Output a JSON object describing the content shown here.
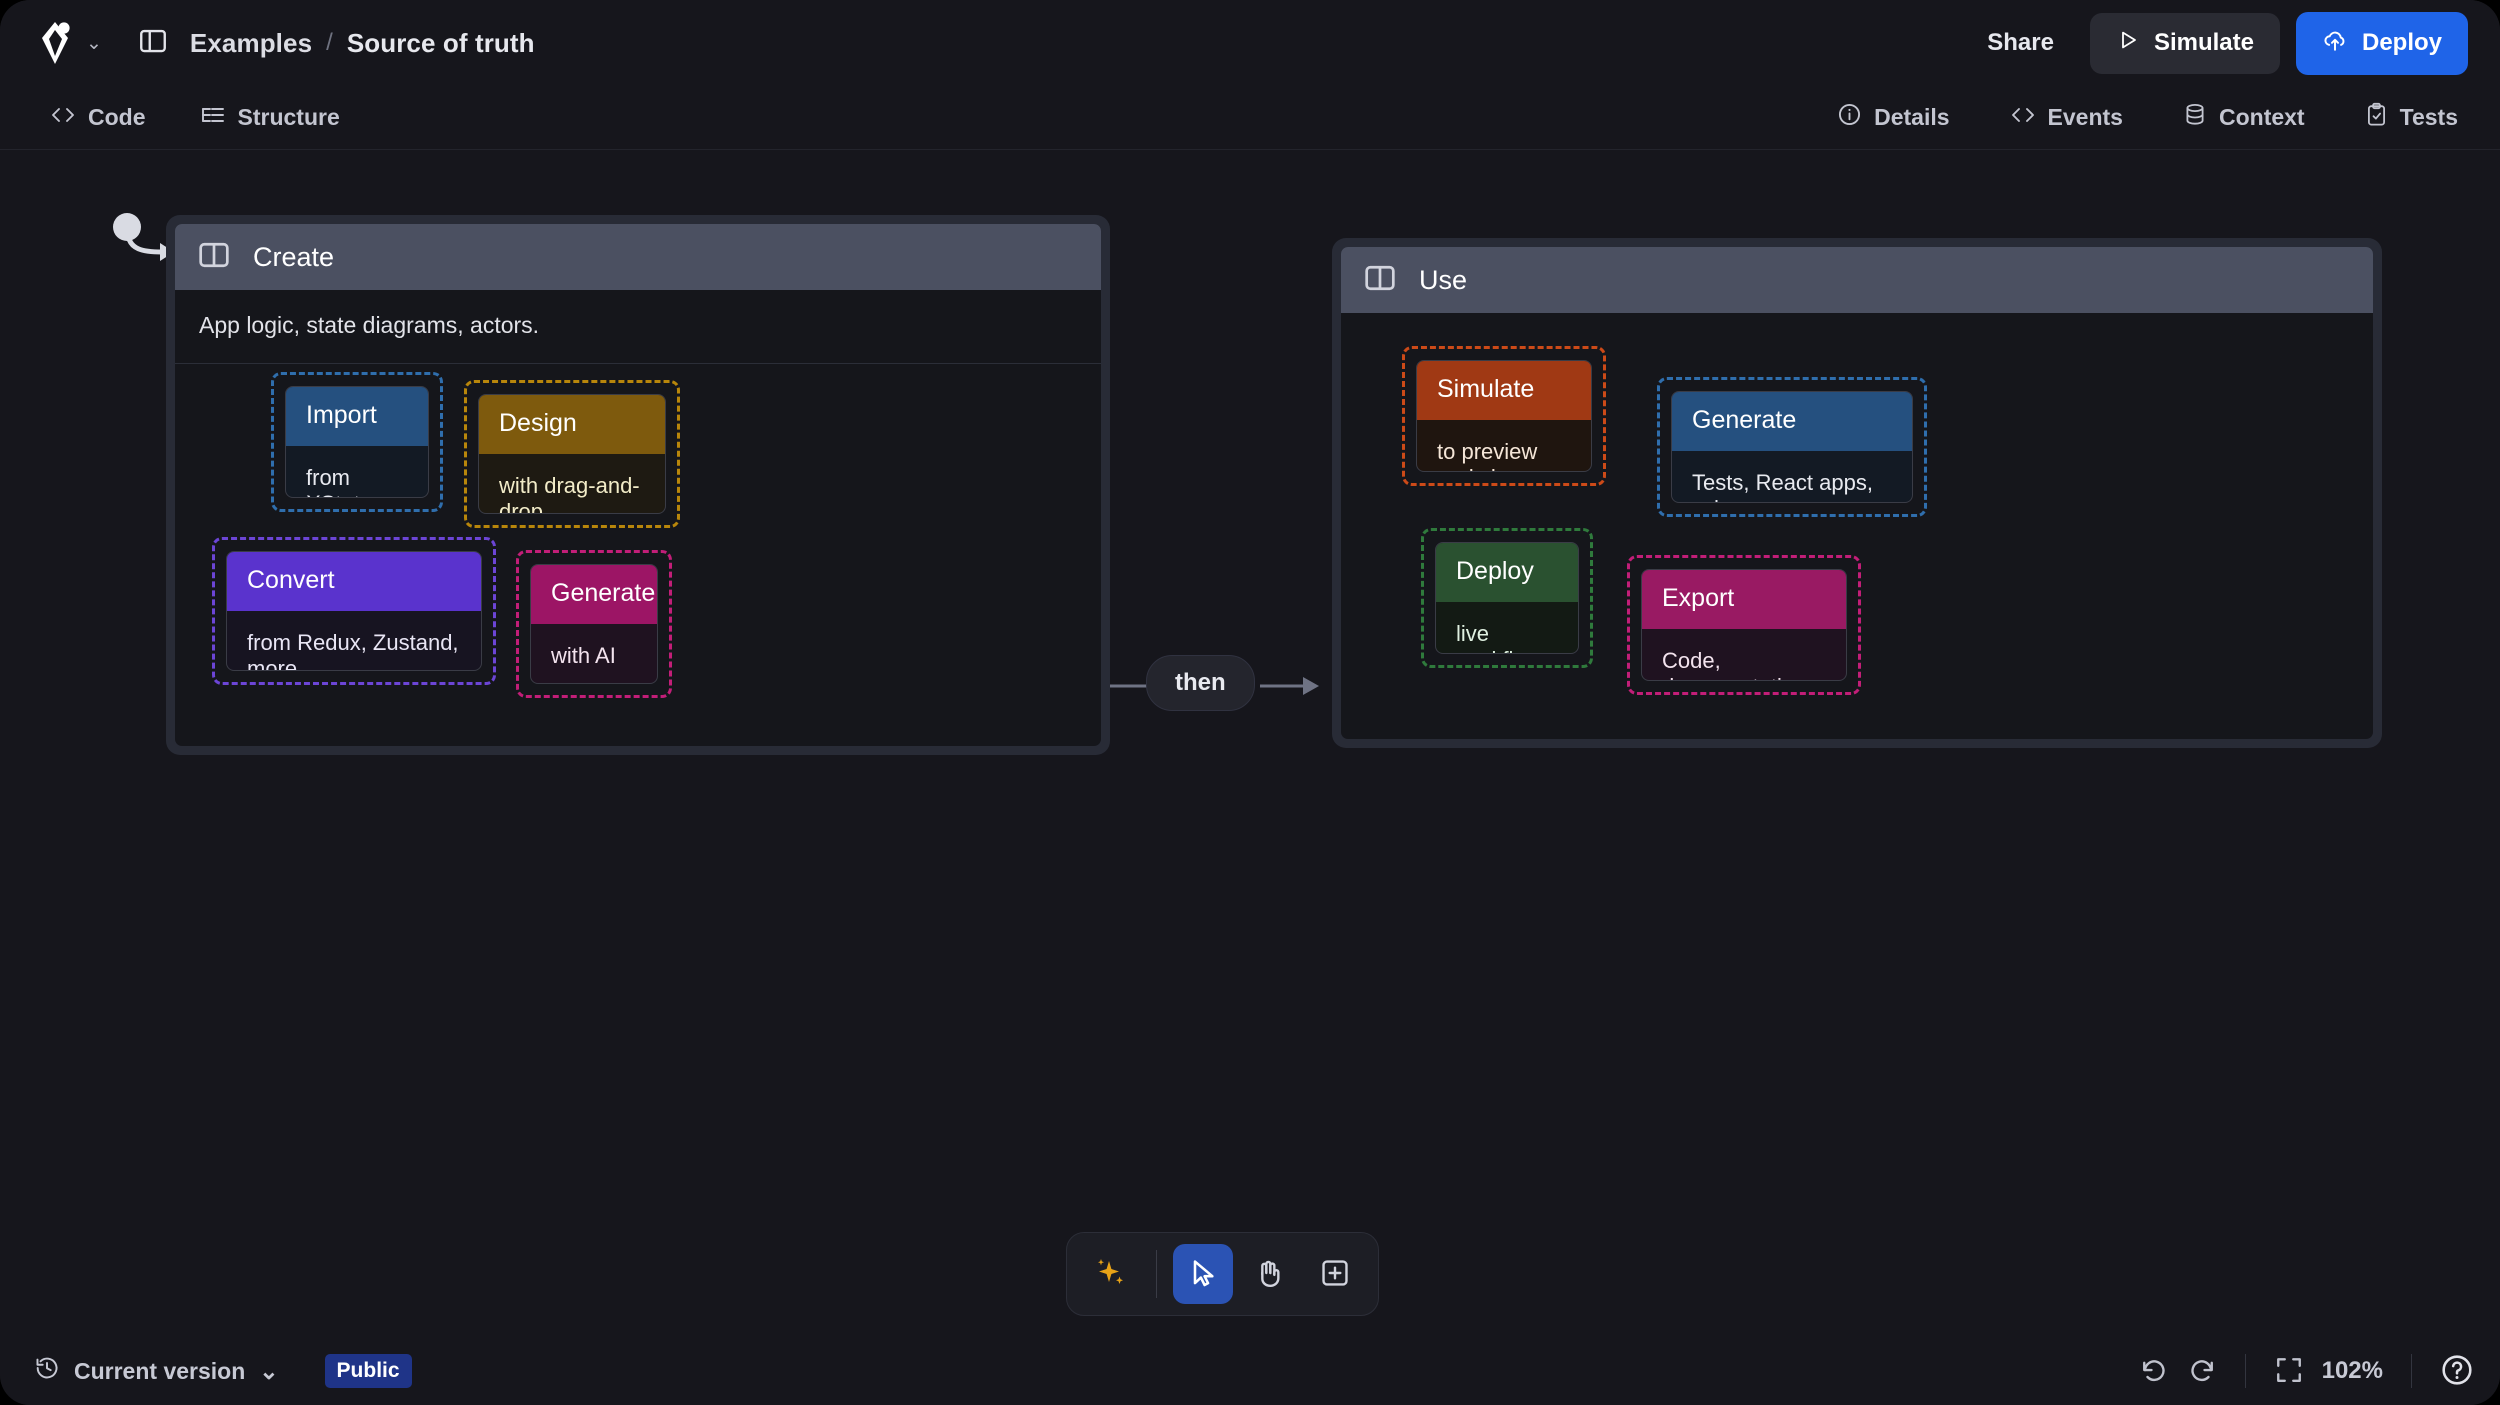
{
  "app": {
    "logo": "stately-logo",
    "breadcrumb": {
      "parent": "Examples",
      "separator": "/",
      "current": "Source of truth"
    }
  },
  "topbar": {
    "panel_toggle_icon": "sidebar-panel-icon",
    "logo_dropdown_icon": "chevron-down-icon",
    "share_label": "Share",
    "simulate_label": "Simulate",
    "simulate_icon": "play-icon",
    "deploy_label": "Deploy",
    "deploy_icon": "cloud-upload-icon",
    "deploy_color": "#1f64e8"
  },
  "tabbar": {
    "left": [
      {
        "label": "Code",
        "icon": "code-brackets-icon"
      },
      {
        "label": "Structure",
        "icon": "list-tree-icon"
      }
    ],
    "right": [
      {
        "label": "Details",
        "icon": "info-circle-icon"
      },
      {
        "label": "Events",
        "icon": "code-brackets-icon"
      },
      {
        "label": "Context",
        "icon": "database-icon"
      },
      {
        "label": "Tests",
        "icon": "clipboard-check-icon"
      }
    ]
  },
  "canvas": {
    "initial_marker": "initial-state-arrow",
    "transition": {
      "label": "then"
    },
    "groups": [
      {
        "id": "create",
        "title": "Create",
        "icon": "group-panel-icon",
        "description": "App logic, state diagrams, actors.",
        "nodes": [
          {
            "id": "import",
            "title": "Import",
            "body": "from XState",
            "header_color": "#25507f",
            "body_color": "#131a24",
            "select_color": "#2f6ead",
            "text_color": "#e8eaf0"
          },
          {
            "id": "design",
            "title": "Design",
            "body": "with drag-and-drop",
            "header_color": "#7e5a0d",
            "body_color": "#1e1a12",
            "select_color": "#b8860b",
            "text_color": "#f2ecc8"
          },
          {
            "id": "convert",
            "title": "Convert",
            "body": "from Redux, Zustand, more",
            "header_color": "#5a33cd",
            "body_color": "#171421",
            "select_color": "#6c45d6",
            "text_color": "#e9e6f5"
          },
          {
            "id": "generate-ai",
            "title": "Generate",
            "body": "with AI",
            "header_color": "#9c1565",
            "body_color": "#1f1220",
            "select_color": "#c21e78",
            "text_color": "#f3e3ee"
          }
        ]
      },
      {
        "id": "use",
        "title": "Use",
        "icon": "group-panel-icon",
        "description": "",
        "nodes": [
          {
            "id": "simulate",
            "title": "Simulate",
            "body": "to preview and share",
            "header_color": "#a03914",
            "body_color": "#1f150f",
            "select_color": "#cc4a18",
            "text_color": "#f5e6d8"
          },
          {
            "id": "generate-tests",
            "title": "Generate",
            "body": "Tests, React apps, schemas",
            "header_color": "#25507f",
            "body_color": "#131a24",
            "select_color": "#2f6ead",
            "text_color": "#e8eaf0"
          },
          {
            "id": "deploy",
            "title": "Deploy",
            "body": "live workflows",
            "header_color": "#2a5130",
            "body_color": "#131a14",
            "select_color": "#2f7a3c",
            "text_color": "#dff0e0"
          },
          {
            "id": "export",
            "title": "Export",
            "body": "Code, documentation",
            "header_color": "#991a63",
            "body_color": "#1f1220",
            "select_color": "#c21e78",
            "text_color": "#f3e3ee"
          }
        ]
      }
    ]
  },
  "toolbar": {
    "items": [
      {
        "id": "ai",
        "icon": "sparkles-icon",
        "active": false
      },
      {
        "id": "select",
        "icon": "cursor-arrow-icon",
        "active": true
      },
      {
        "id": "pan",
        "icon": "hand-icon",
        "active": false
      },
      {
        "id": "add",
        "icon": "add-box-icon",
        "active": false
      }
    ]
  },
  "statusbar": {
    "version_label": "Current version",
    "version_icon": "history-clock-icon",
    "version_chevron": "chevron-down-icon",
    "visibility_badge": "Public",
    "undo_icon": "undo-arrow-icon",
    "redo_icon": "redo-arrow-icon",
    "fit_icon": "fit-view-icon",
    "zoom_level": "102%",
    "help_icon": "question-circle-icon"
  }
}
